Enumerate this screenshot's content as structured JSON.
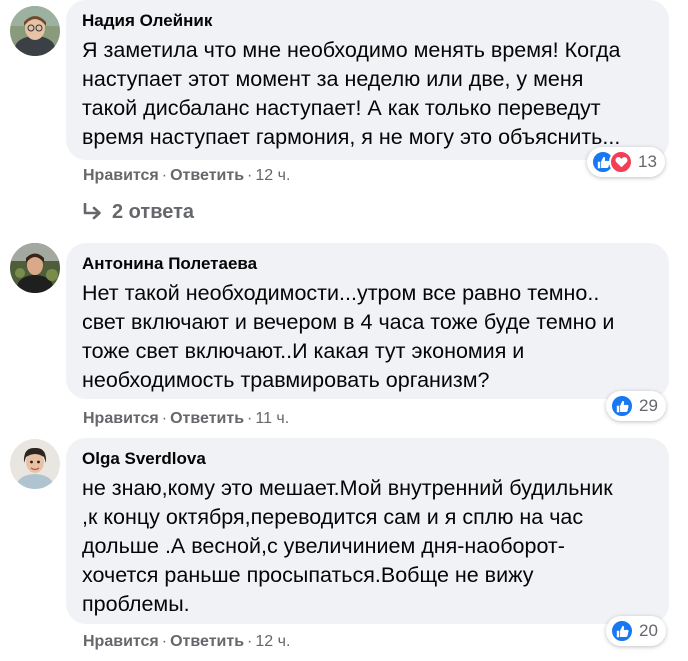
{
  "comments": [
    {
      "author": "Надия Олейник",
      "text": "Я заметила что мне необходимо менять время! Когда\nнаступает этот момент за неделю или две, у меня\nтакой дисбаланс наступает! А как только переведут\nвремя наступает гармония, я не могу это объяснить...",
      "like_label": "Нравится",
      "reply_label": "Ответить",
      "time": "12 ч.",
      "reaction_count": "13",
      "reactions": [
        "like-icon",
        "love-icon"
      ],
      "replies_label": "2 ответа"
    },
    {
      "author": "Антонина Полетаева",
      "text": "Нет такой необходимости...утром все равно темно..\nсвет включают и вечером в 4 часа тоже буде темно и\nтоже свет включают..И какая тут экономия и\nнеобходимость травмировать организм?",
      "like_label": "Нравится",
      "reply_label": "Ответить",
      "time": "11 ч.",
      "reaction_count": "29",
      "reactions": [
        "like-icon"
      ]
    },
    {
      "author": "Olga Sverdlova",
      "text": "не знаю,кому это мешает.Мой внутренний будильник\n,к концу октября,переводится сам и я сплю на час\nдольше .А весной,с увеличинием дня-наоборот-\nхочется раньше просыпаться.Вобще не вижу\nпроблемы.",
      "like_label": "Нравится",
      "reply_label": "Ответить",
      "time": "12 ч.",
      "reaction_count": "20",
      "reactions": [
        "like-icon"
      ]
    }
  ],
  "colors": {
    "bubble": "#f0f2f5",
    "meta": "#65676b",
    "like": "#1877f2",
    "love": "#f33e58"
  }
}
